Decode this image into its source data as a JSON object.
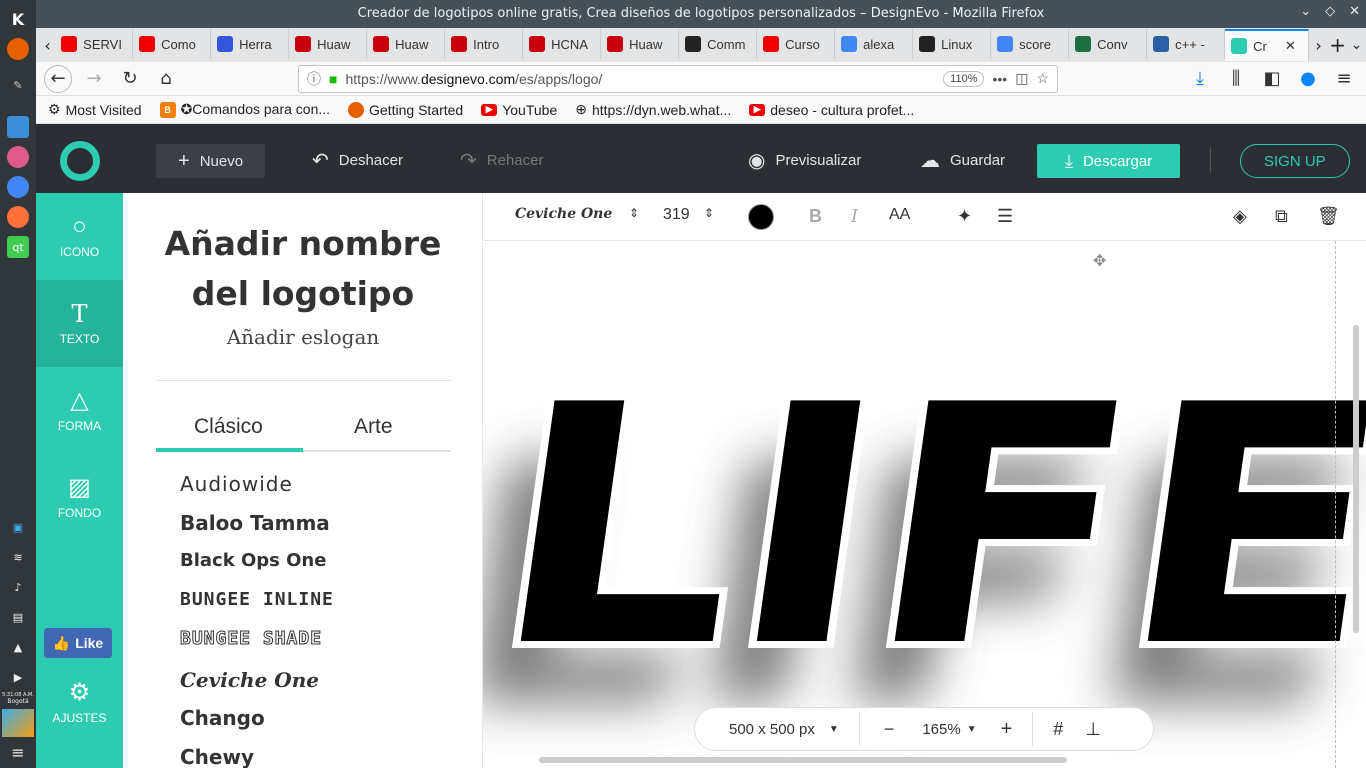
{
  "window": {
    "title": "Creador de logotipos online gratis, Crea diseños de logotipos personalizados – DesignEvo - Mozilla Firefox"
  },
  "tabs": [
    {
      "label": "SERVI",
      "color": "#e00"
    },
    {
      "label": "Como",
      "color": "#e00"
    },
    {
      "label": "Herra",
      "color": "#3455db"
    },
    {
      "label": "Huaw",
      "color": "#c7000b"
    },
    {
      "label": "Huaw",
      "color": "#c7000b"
    },
    {
      "label": "Intro",
      "color": "#c7000b"
    },
    {
      "label": "HCNA",
      "color": "#c7000b"
    },
    {
      "label": "Huaw",
      "color": "#c7000b"
    },
    {
      "label": "Comm",
      "color": "#222"
    },
    {
      "label": "Curso",
      "color": "#e00"
    },
    {
      "label": "alexa",
      "color": "#4285f4"
    },
    {
      "label": "Linux",
      "color": "#222"
    },
    {
      "label": "score",
      "color": "#4285f4"
    },
    {
      "label": "Conv",
      "color": "#1d6f42"
    },
    {
      "label": "c++ -",
      "color": "#2d5fa6"
    },
    {
      "label": "Cr",
      "color": "#2dcbb1"
    }
  ],
  "nav": {
    "url_domain_prefix": "https://www.",
    "url_domain": "designevo.com",
    "url_path": "/es/apps/logo/",
    "zoom": "110%"
  },
  "bookmarks": [
    {
      "label": "Most Visited"
    },
    {
      "label": "✪Comandos para con..."
    },
    {
      "label": "Getting Started"
    },
    {
      "label": "YouTube"
    },
    {
      "label": "https://dyn.web.what..."
    },
    {
      "label": "deseo - cultura profet..."
    }
  ],
  "header": {
    "nuevo": "Nuevo",
    "deshacer": "Deshacer",
    "rehacer": "Rehacer",
    "previsualizar": "Previsualizar",
    "guardar": "Guardar",
    "descargar": "Descargar",
    "signup": "SIGN UP"
  },
  "sidebar": {
    "icono": "ICONO",
    "texto": "TEXTO",
    "forma": "FORMA",
    "fondo": "FONDO",
    "like": "Like",
    "ajustes": "AJUSTES"
  },
  "panel": {
    "logo_name_line1": "Añadir nombre",
    "logo_name_line2": "del logotipo",
    "slogan": "Añadir eslogan",
    "tab_clasico": "Clásico",
    "tab_arte": "Arte",
    "fonts": [
      "Audiowide",
      "Baloo Tamma",
      "Black Ops One",
      "BUNGEE INLINE",
      "BUNGEE SHADE",
      "Ceviche One",
      "Chango",
      "Chewy"
    ]
  },
  "toolbar": {
    "font": "Ceviche One",
    "size": "319",
    "color": "#000000",
    "bold": "B",
    "italic": "I",
    "case": "AA"
  },
  "canvas": {
    "text": "LIFE"
  },
  "bottom": {
    "canvas_size": "500 x 500 px",
    "zoom": "165%"
  },
  "clock": {
    "time": "5:31:08 A.M.",
    "place": "Bogotá"
  }
}
